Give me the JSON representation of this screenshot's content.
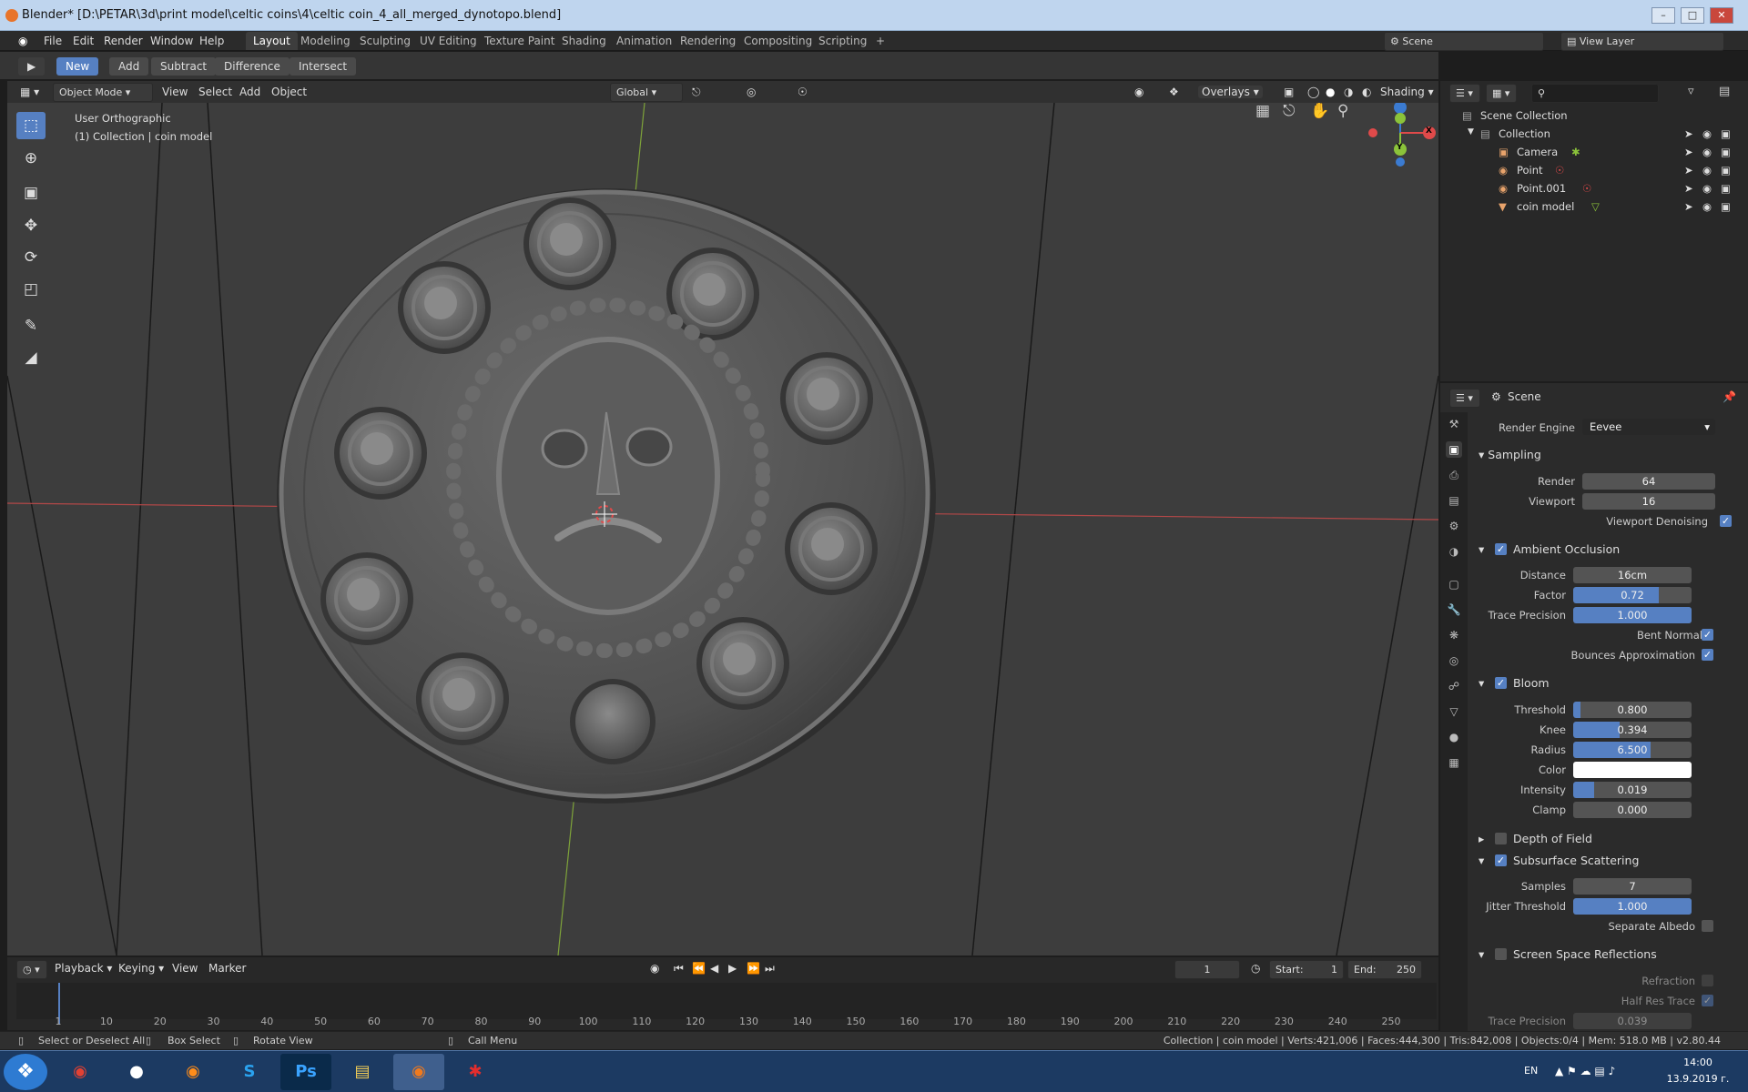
{
  "window": {
    "title": "Blender* [D:\\PETAR\\3d\\print model\\celtic coins\\4\\celtic coin_4_all_merged_dynotopo.blend]"
  },
  "menu": {
    "items": [
      "File",
      "Edit",
      "Render",
      "Window",
      "Help"
    ]
  },
  "workspaces": [
    "Layout",
    "Modeling",
    "Sculpting",
    "UV Editing",
    "Texture Paint",
    "Shading",
    "Animation",
    "Rendering",
    "Compositing",
    "Scripting",
    "+"
  ],
  "scene": {
    "name": "Scene",
    "view_layer": "View Layer"
  },
  "toolrow": {
    "buttons": [
      "New",
      "Add",
      "Subtract",
      "Difference",
      "Intersect"
    ]
  },
  "viewport_header": {
    "mode": "Object Mode",
    "view": "View",
    "select": "Select",
    "add": "Add",
    "object": "Object",
    "orientation": "Global",
    "overlays": "Overlays",
    "shading": "Shading"
  },
  "viewport": {
    "view_name": "User Orthographic",
    "collection_info": "(1) Collection | coin model"
  },
  "gizmo": {
    "z": "Z",
    "y": "Y",
    "x": "X"
  },
  "outliner": {
    "root": "Scene Collection",
    "collection": "Collection",
    "items": [
      "Camera",
      "Point",
      "Point.001",
      "coin model"
    ]
  },
  "properties": {
    "context": "Scene",
    "render_engine_label": "Render Engine",
    "render_engine": "Eevee",
    "sampling": {
      "title": "Sampling",
      "render_label": "Render",
      "render": "64",
      "viewport_label": "Viewport",
      "viewport": "16",
      "denoise_label": "Viewport Denoising"
    },
    "ao": {
      "title": "Ambient Occlusion",
      "distance_label": "Distance",
      "distance": "16cm",
      "factor_label": "Factor",
      "factor": "0.72",
      "factor_fill": 0.72,
      "trace_label": "Trace Precision",
      "trace": "1.000",
      "trace_fill": 1.0,
      "bent_label": "Bent Normals",
      "bounces_label": "Bounces Approximation"
    },
    "bloom": {
      "title": "Bloom",
      "threshold_label": "Threshold",
      "threshold": "0.800",
      "threshold_fill": 0.06,
      "knee_label": "Knee",
      "knee": "0.394",
      "knee_fill": 0.39,
      "radius_label": "Radius",
      "radius": "6.500",
      "radius_fill": 0.65,
      "color_label": "Color",
      "color_value": "#ffffff",
      "intensity_label": "Intensity",
      "intensity": "0.019",
      "intensity_fill": 0.18,
      "clamp_label": "Clamp",
      "clamp": "0.000"
    },
    "dof": {
      "title": "Depth of Field"
    },
    "sss": {
      "title": "Subsurface Scattering",
      "samples_label": "Samples",
      "samples": "7",
      "jitter_label": "Jitter Threshold",
      "jitter": "1.000",
      "jitter_fill": 1.0,
      "albedo_label": "Separate Albedo"
    },
    "ssr": {
      "title": "Screen Space Reflections",
      "refraction_label": "Refraction",
      "halfres_label": "Half Res Trace",
      "trace_label": "Trace Precision",
      "trace": "0.039"
    }
  },
  "timeline": {
    "playback": "Playback",
    "keying": "Keying",
    "view": "View",
    "marker": "Marker",
    "current_frame": "1",
    "start_label": "Start:",
    "start": "1",
    "end_label": "End:",
    "end": "250",
    "ticks": [
      "1",
      "10",
      "20",
      "30",
      "40",
      "50",
      "60",
      "70",
      "80",
      "90",
      "100",
      "110",
      "120",
      "130",
      "140",
      "150",
      "160",
      "170",
      "180",
      "190",
      "200",
      "210",
      "220",
      "230",
      "240",
      "250"
    ]
  },
  "status": {
    "left1": "Select or Deselect All",
    "left2": "Box Select",
    "left3": "Rotate View",
    "middle": "Call Menu",
    "right": "Collection | coin model | Verts:421,006 | Faces:444,300 | Tris:842,008 | Objects:0/4 | Mem: 518.0 MB | v2.80.44"
  },
  "taskbar": {
    "lang": "EN",
    "time": "14:00",
    "date": "13.9.2019 г."
  },
  "colors": {
    "accent": "#5680c2",
    "x_axis": "#e04a4a",
    "y_axis": "#8bc33a",
    "z_axis": "#3b7bd1"
  }
}
